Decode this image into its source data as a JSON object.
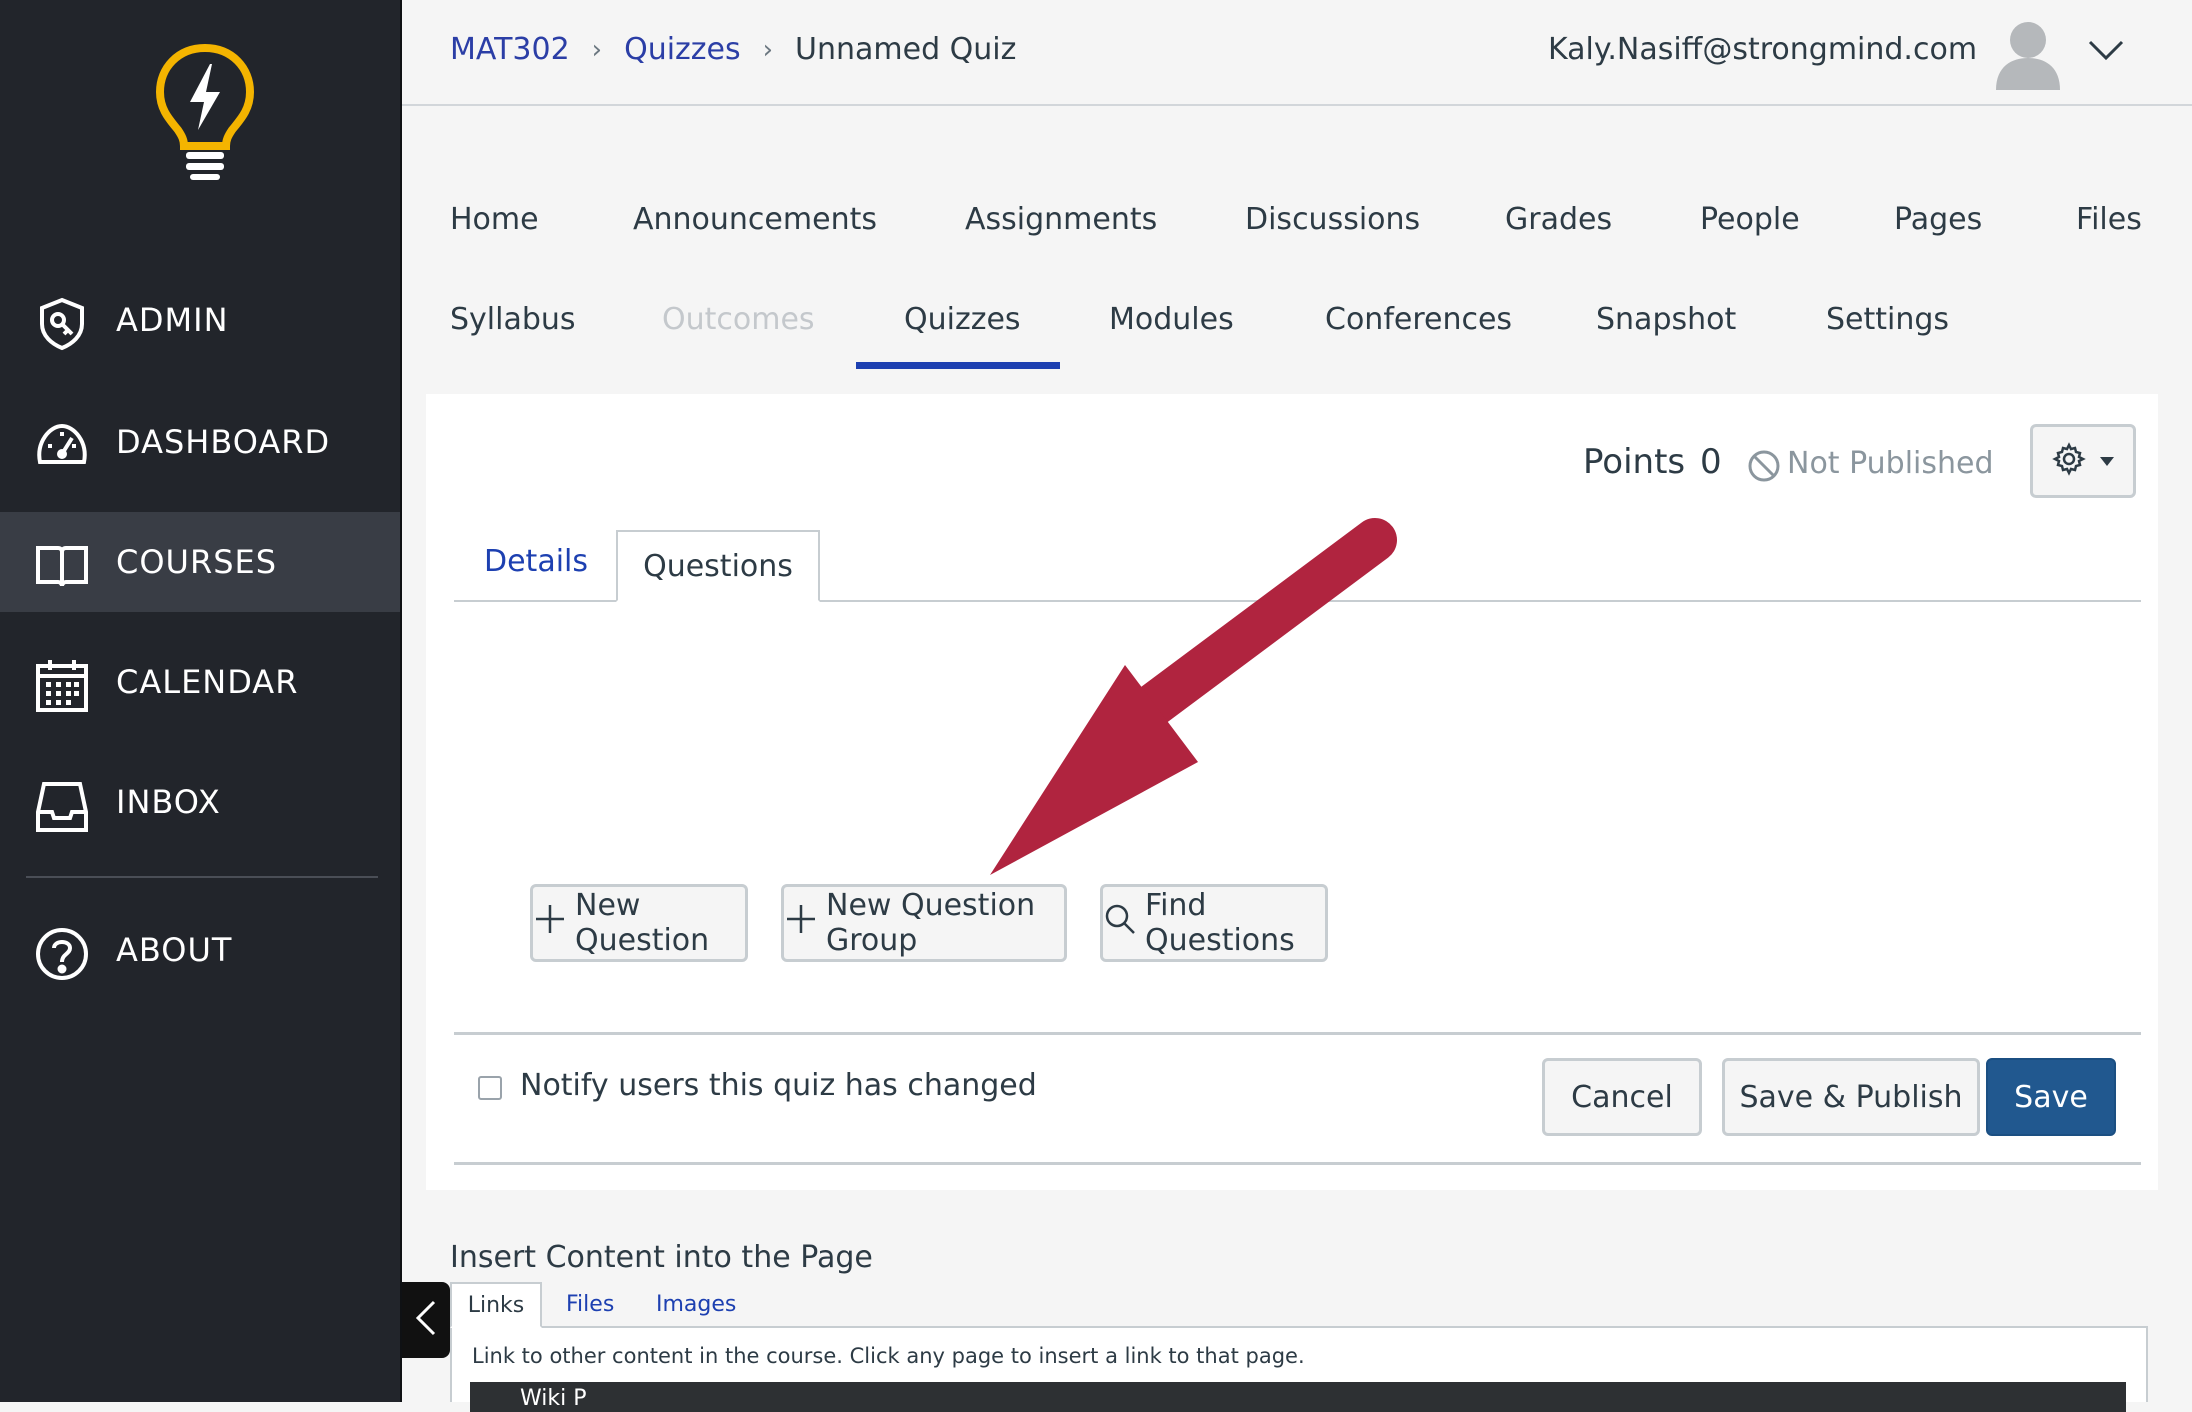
{
  "global_nav": {
    "logo": "lightbulb-logo",
    "items": [
      {
        "label": "ADMIN",
        "icon": "shield-key-icon"
      },
      {
        "label": "DASHBOARD",
        "icon": "speedometer-icon"
      },
      {
        "label": "COURSES",
        "icon": "book-icon",
        "active": true
      },
      {
        "label": "CALENDAR",
        "icon": "calendar-icon"
      },
      {
        "label": "INBOX",
        "icon": "inbox-icon"
      },
      {
        "label": "ABOUT",
        "icon": "question-circle-icon"
      }
    ]
  },
  "header": {
    "breadcrumb": [
      "MAT302",
      "Quizzes",
      "Unnamed Quiz"
    ],
    "user_email": "Kaly.Nasiff@strongmind.com"
  },
  "course_nav": {
    "row1": [
      "Home",
      "Announcements",
      "Assignments",
      "Discussions",
      "Grades",
      "People",
      "Pages",
      "Files"
    ],
    "row2": [
      "Syllabus",
      "Outcomes",
      "Quizzes",
      "Modules",
      "Conferences",
      "Snapshot",
      "Settings"
    ],
    "active": "Quizzes",
    "disabled": [
      "Outcomes"
    ]
  },
  "quiz": {
    "points_label": "Points",
    "points_value": "0",
    "status": "Not Published",
    "tabs": [
      "Details",
      "Questions"
    ],
    "active_tab": "Questions",
    "buttons": {
      "new_question": "New Question",
      "new_question_group": "New Question Group",
      "find_questions": "Find Questions"
    },
    "notify_label": "Notify users this quiz has changed",
    "notify_checked": false,
    "actions": {
      "cancel": "Cancel",
      "save_publish": "Save & Publish",
      "save": "Save"
    }
  },
  "insert_content": {
    "title": "Insert Content into the Page",
    "tabs": [
      "Links",
      "Files",
      "Images"
    ],
    "description": "Link to other content in the course. Click any page to insert a link to that page.",
    "first_item": "Wiki P"
  },
  "colors": {
    "nav_bg": "#22252b",
    "nav_active": "#393d45",
    "link": "#2b3ea6",
    "primary_button": "#21588f",
    "annotation_arrow": "#b0243f",
    "logo": "#f4b400"
  }
}
